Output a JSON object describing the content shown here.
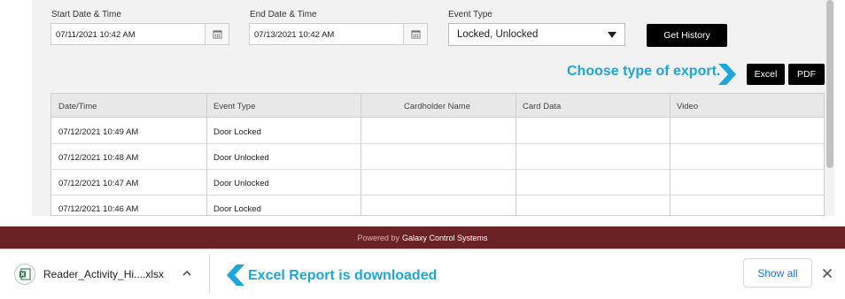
{
  "filters": {
    "start": {
      "label": "Start Date & Time",
      "value": "07/11/2021 10:42 AM"
    },
    "end": {
      "label": "End Date & Time",
      "value": "07/13/2021 10:42 AM"
    },
    "event_type": {
      "label": "Event Type",
      "value": "Locked, Unlocked"
    },
    "get_history_label": "Get History"
  },
  "export": {
    "annotation": "Choose type of export.",
    "excel_label": "Excel",
    "pdf_label": "PDF"
  },
  "table": {
    "headers": [
      "Date/Time",
      "Event Type",
      "Cardholder Name",
      "Card Data",
      "Video"
    ],
    "rows": [
      {
        "datetime": "07/12/2021 10:49 AM",
        "event": "Door Locked",
        "cardholder": "",
        "card_data": "",
        "video": ""
      },
      {
        "datetime": "07/12/2021 10:48 AM",
        "event": "Door Unlocked",
        "cardholder": "",
        "card_data": "",
        "video": ""
      },
      {
        "datetime": "07/12/2021 10:47 AM",
        "event": "Door Unlocked",
        "cardholder": "",
        "card_data": "",
        "video": ""
      },
      {
        "datetime": "07/12/2021 10:46 AM",
        "event": "Door Locked",
        "cardholder": "",
        "card_data": "",
        "video": ""
      }
    ]
  },
  "footer": {
    "prefix": "Powered by",
    "company": "Galaxy Control Systems"
  },
  "download_bar": {
    "file_name": "Reader_Activity_Hi....xlsx",
    "annotation": "Excel Report is downloaded",
    "show_all_label": "Show all",
    "file_icon": "excel-file-icon"
  },
  "colors": {
    "annotation": "#1ea6d8",
    "footer_bg": "#6b2224",
    "button_bg": "#000000",
    "link_blue": "#1a73e8"
  }
}
